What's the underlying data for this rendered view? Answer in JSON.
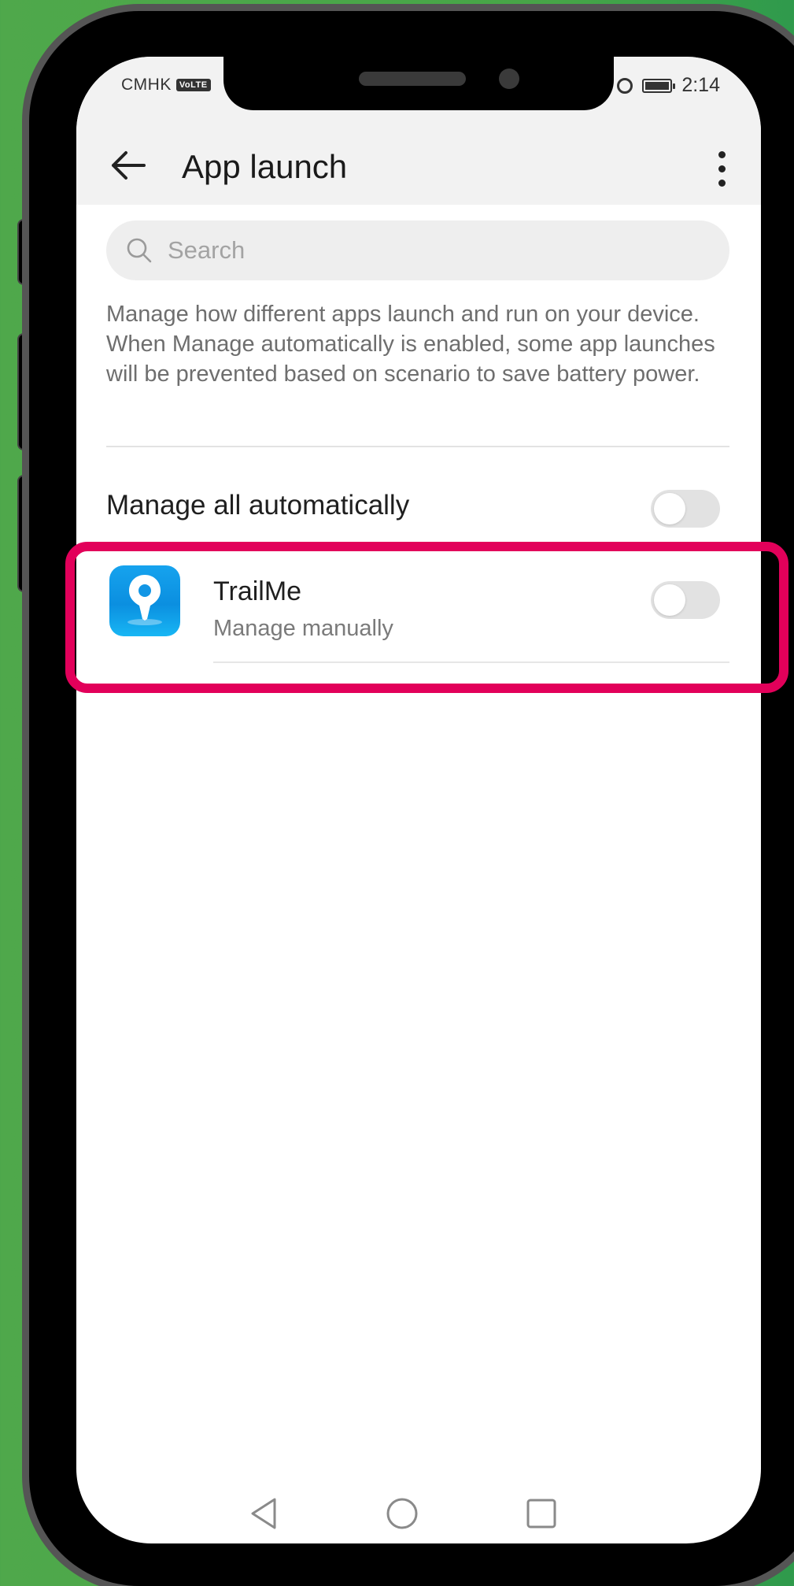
{
  "status_bar": {
    "carrier": "CMHK",
    "volte_badge": "VoLTE",
    "time": "2:14",
    "icons": [
      "signal-icon",
      "alarm-icon",
      "battery-icon"
    ]
  },
  "header": {
    "title": "App launch",
    "back_icon": "arrow-left-icon",
    "more_icon": "more-vertical-icon"
  },
  "search": {
    "placeholder": "Search",
    "value": ""
  },
  "description": "Manage how different apps launch and run on your device. When Manage automatically is enabled, some app launches will be prevented based on scenario to save battery power.",
  "manage_all": {
    "label": "Manage all automatically",
    "enabled": false
  },
  "apps": [
    {
      "name": "TrailMe",
      "status": "Manage manually",
      "icon": "location-pin-icon",
      "enabled": false
    }
  ],
  "nav": {
    "back_icon": "triangle-back-icon",
    "home_icon": "circle-home-icon",
    "recents_icon": "square-recents-icon"
  },
  "colors": {
    "background_green": "#4fa84b",
    "highlight": "#e2005a",
    "app_icon_blue": "#0b8fe0",
    "toggle_off": "#e2e2e2"
  }
}
